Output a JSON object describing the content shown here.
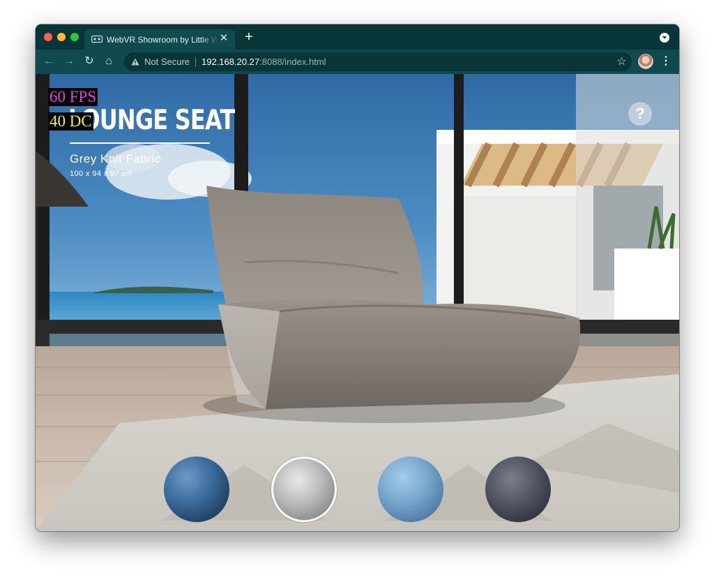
{
  "browser": {
    "tab": {
      "title": "WebVR Showroom by Little Workshop",
      "close_glyph": "✕"
    },
    "new_tab_glyph": "+",
    "nav": {
      "back": "←",
      "forward": "→",
      "reload": "↻",
      "home": "⌂"
    },
    "omnibox": {
      "security_label": "Not Secure",
      "url_host": "192.168.20.27",
      "url_rest": ":8088/index.html"
    },
    "star_glyph": "☆",
    "menu_glyph": "⋮",
    "colors": {
      "frame": "#083538",
      "toolbar": "#0f4a4e"
    }
  },
  "overlay": {
    "fps": "60 FPS",
    "draw_calls": "40 DC",
    "fps_color": "#e43fe6",
    "dc_color": "#f4f424"
  },
  "product": {
    "title": "LOUNGE SEAT",
    "fabric": "Grey Knit Fabric",
    "dimensions": "100 x 94 x 97 cm"
  },
  "help": {
    "glyph": "?"
  },
  "swatches": [
    {
      "name": "blue",
      "selected": false,
      "color": "#3f6f9f"
    },
    {
      "name": "grey",
      "selected": true,
      "color": "#b8b8b8"
    },
    {
      "name": "light-blue",
      "selected": false,
      "color": "#79a8cf"
    },
    {
      "name": "charcoal",
      "selected": false,
      "color": "#4f525f"
    }
  ]
}
